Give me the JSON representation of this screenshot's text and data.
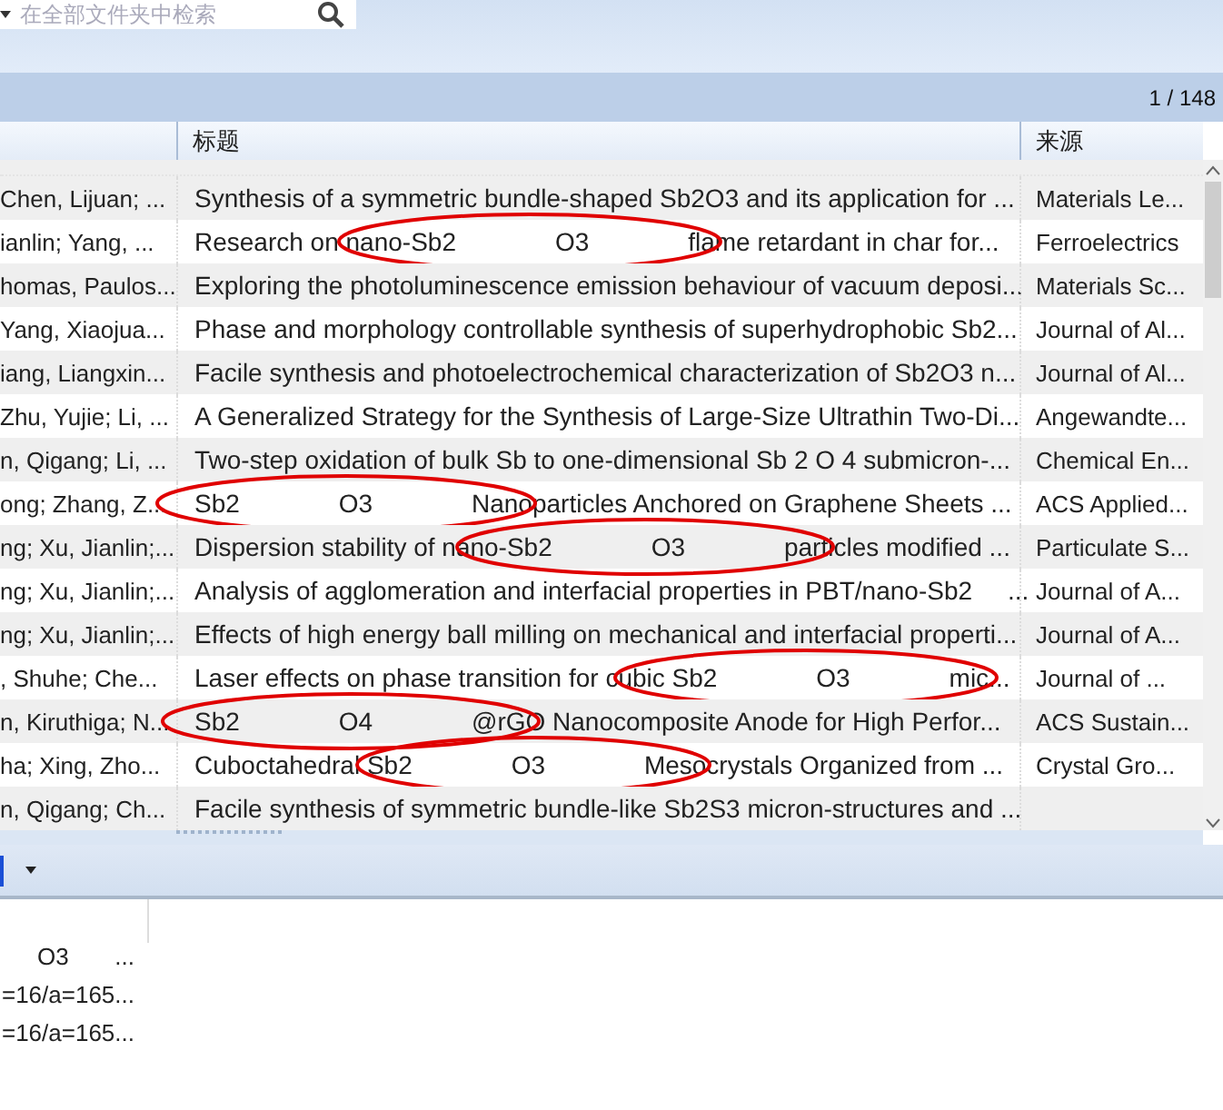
{
  "search": {
    "placeholder": "在全部文件夹中检索"
  },
  "pager": "1 / 148",
  "table": {
    "columns": [
      {
        "label": "标题"
      },
      {
        "label": "来源"
      }
    ],
    "rows": [
      {
        "author": "Chen, Lijuan; ...",
        "title": "Synthesis of a symmetric bundle-shaped Sb2O3 and its application for ...",
        "source": "Materials Le...",
        "circled": false
      },
      {
        "author": "ianlin; Yang, ...",
        "title": "Research on nano-Sb2              O3              flame retardant in char for...",
        "source": "Ferroelectrics",
        "circled": true
      },
      {
        "author": "homas, Paulos...",
        "title": "Exploring the photoluminescence emission behaviour of vacuum deposi...",
        "source": "Materials Sc...",
        "circled": false
      },
      {
        "author": "Yang, Xiaojua...",
        "title": "Phase and morphology controllable synthesis of superhydrophobic Sb2...",
        "source": "Journal of Al...",
        "circled": false
      },
      {
        "author": "iang, Liangxin...",
        "title": "Facile synthesis and photoelectrochemical characterization of Sb2O3 n...",
        "source": "Journal of Al...",
        "circled": false
      },
      {
        "author": "Zhu, Yujie; Li, ...",
        "title": "A Generalized Strategy for the Synthesis of Large-Size Ultrathin Two-Di...",
        "source": "Angewandte...",
        "circled": false
      },
      {
        "author": "n, Qigang; Li, ...",
        "title": "Two-step oxidation of bulk Sb to one-dimensional Sb 2 O 4 submicron-...",
        "source": "Chemical En...",
        "circled": false
      },
      {
        "author": "ong; Zhang, Z...",
        "title": "Sb2              O3              Nanoparticles Anchored on Graphene Sheets ...",
        "source": "ACS Applied...",
        "circled": true
      },
      {
        "author": "ng; Xu, Jianlin;...",
        "title": "Dispersion stability of nano-Sb2              O3              particles modified ...",
        "source": "Particulate S...",
        "circled": true
      },
      {
        "author": "ng; Xu, Jianlin;...",
        "title": "Analysis of agglomeration and interfacial properties in PBT/nano-Sb2     ...",
        "source": "Journal of A...",
        "circled": false
      },
      {
        "author": "ng; Xu, Jianlin;...",
        "title": "Effects of high energy ball milling on mechanical and interfacial properti...",
        "source": "Journal of A...",
        "circled": false
      },
      {
        "author": ", Shuhe; Che...",
        "title": "Laser effects on phase transition for cubic Sb2              O3              mic...",
        "source": "Journal of ...",
        "circled": true
      },
      {
        "author": "n, Kiruthiga; N...",
        "title": "Sb2              O4              @rGO Nanocomposite Anode for High Perfor...",
        "source": "ACS Sustain...",
        "circled": true
      },
      {
        "author": "ha; Xing, Zho...",
        "title": "Cuboctahedral Sb2              O3              Mesocrystals Organized from ...",
        "source": "Crystal Gro...",
        "circled": true
      },
      {
        "author": "n, Qigang; Ch...",
        "title": "Facile synthesis of symmetric bundle-like Sb2S3 micron-structures and ...",
        "circled": false
      }
    ]
  },
  "details": [
    "O3       ...",
    "=16/a=165...",
    "=16/a=165..."
  ]
}
